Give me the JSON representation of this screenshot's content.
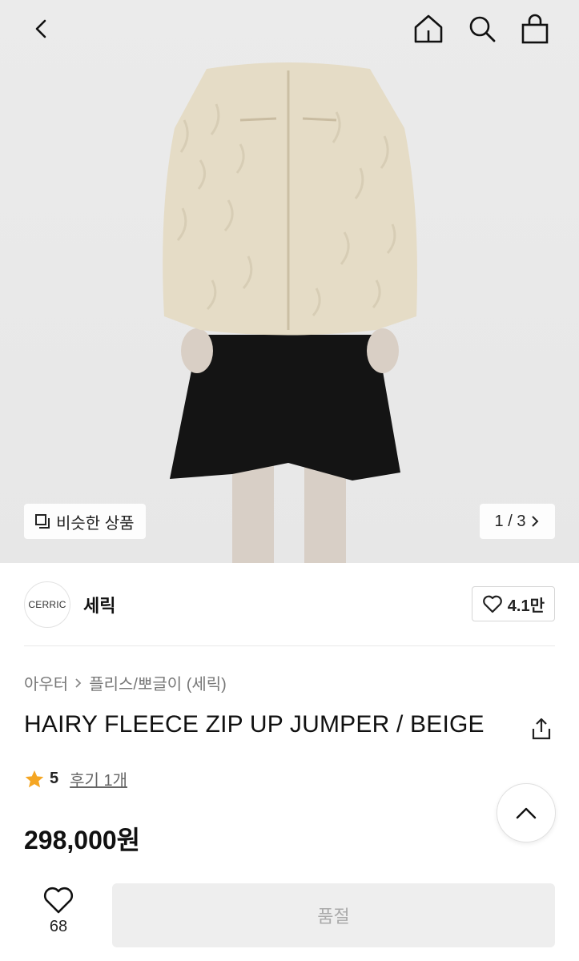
{
  "similar_button": {
    "label": "비슷한 상품"
  },
  "pager": {
    "text": "1 / 3"
  },
  "brand": {
    "logo_text": "CERRIC",
    "name": "세릭",
    "likes": "4.1만"
  },
  "breadcrumb": {
    "category": "아우터",
    "subcategory": "플리스/뽀글이 (세릭)"
  },
  "product": {
    "title": "HAIRY FLEECE ZIP UP JUMPER / BEIGE",
    "rating": "5",
    "reviews": "후기 1개",
    "price": "298,000원"
  },
  "bottom": {
    "wish_count": "68",
    "soldout_label": "품절"
  },
  "colors": {
    "rating_star": "#f5a623",
    "soldout_bg": "#eeeeee",
    "soldout_text": "#aaaaaa"
  },
  "icons": [
    "back-icon",
    "home-icon",
    "search-icon",
    "bag-icon",
    "similar-icon",
    "chevron-right-icon",
    "heart-icon",
    "share-icon",
    "star-icon",
    "chevron-up-icon"
  ]
}
